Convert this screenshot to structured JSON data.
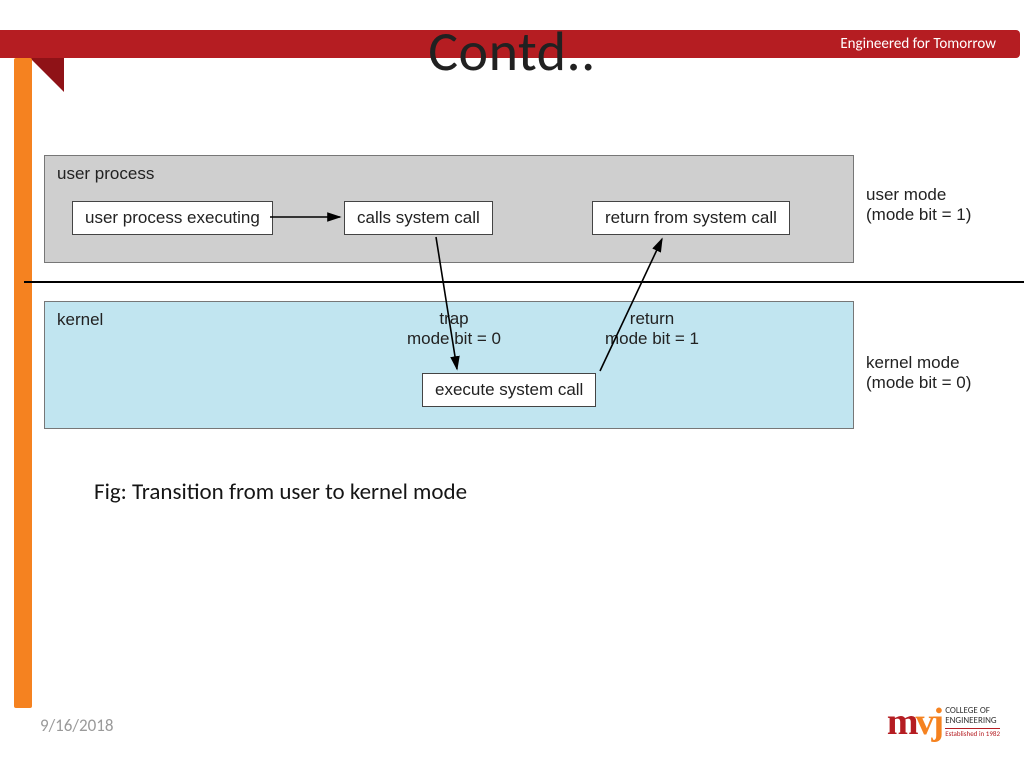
{
  "header": {
    "tagline": "Engineered for Tomorrow"
  },
  "slide": {
    "title": "Contd..",
    "caption": "Fig: Transition from user to kernel mode"
  },
  "diagram": {
    "user_block_label": "user process",
    "kernel_block_label": "kernel",
    "user_mode_caption_line1": "user mode",
    "user_mode_caption_line2": "(mode bit = 1)",
    "kernel_mode_caption_line1": "kernel mode",
    "kernel_mode_caption_line2": "(mode bit = 0)",
    "nodes": {
      "user_process_executing": "user process executing",
      "calls_system_call": "calls system call",
      "return_from_system_call": "return from system call",
      "execute_system_call": "execute system call"
    },
    "trap_label_line1": "trap",
    "trap_label_line2": "mode bit = 0",
    "return_label_line1": "return",
    "return_label_line2": "mode bit = 1"
  },
  "footer": {
    "date": "9/16/2018"
  },
  "logo": {
    "part1": "m",
    "part2": "vj",
    "line1": "COLLEGE OF",
    "line2": "ENGINEERING",
    "established": "Established in 1982"
  }
}
